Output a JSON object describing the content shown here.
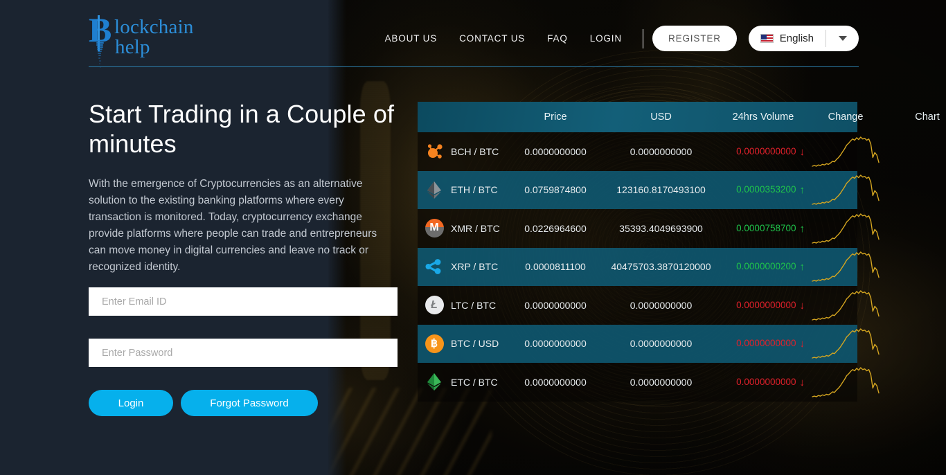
{
  "brand": {
    "logo_line1": "lockchain",
    "logo_line2": "help",
    "logo_initial": "B"
  },
  "header": {
    "nav": [
      {
        "label": "ABOUT US"
      },
      {
        "label": "CONTACT US"
      },
      {
        "label": "FAQ"
      },
      {
        "label": "LOGIN"
      }
    ],
    "register_label": "REGISTER",
    "language": {
      "label": "English",
      "flag_icon": "us-flag-icon",
      "caret_icon": "chevron-down-icon"
    }
  },
  "hero": {
    "title": "Start Trading in a Couple of minutes",
    "paragraph": "With the emergence of Cryptocurrencies as an alternative solution to the existing banking platforms where every transaction is monitored. Today, cryptocurrency exchange provide platforms where people can trade and entrepreneurs can move money in digital currencies and leave no track or recognized identity.",
    "email_placeholder": "Enter Email ID",
    "email_value": "",
    "password_placeholder": "Enter Password",
    "password_value": "",
    "login_label": "Login",
    "forgot_label": "Forgot Password"
  },
  "market": {
    "columns": [
      {
        "key": "icon",
        "label": ""
      },
      {
        "key": "pair",
        "label": ""
      },
      {
        "key": "price",
        "label": "Price"
      },
      {
        "key": "usd",
        "label": "USD"
      },
      {
        "key": "vol",
        "label": "24hrs Volume"
      },
      {
        "key": "chg",
        "label": "Change"
      },
      {
        "key": "chart",
        "label": "Chart"
      }
    ],
    "colors": {
      "header_bg": "#0f5066",
      "row_alt_bg": "#0e556e",
      "up": "#1fc44b",
      "down": "#e2202b",
      "spark": "#d4a520"
    },
    "rows": [
      {
        "icon": "bch-icon",
        "pair": "BCH / BTC",
        "price": "0.0000000000",
        "volume": "0.0000000000",
        "change": "0.0000000000",
        "direction": "down",
        "highlight": false
      },
      {
        "icon": "eth-icon",
        "pair": "ETH / BTC",
        "price": "0.0759874800",
        "volume": "123160.8170493100",
        "change": "0.0000353200",
        "direction": "up",
        "highlight": true
      },
      {
        "icon": "xmr-icon",
        "pair": "XMR / BTC",
        "price": "0.0226964600",
        "volume": "35393.4049693900",
        "change": "0.0000758700",
        "direction": "up",
        "highlight": false
      },
      {
        "icon": "xrp-icon",
        "pair": "XRP / BTC",
        "price": "0.0000811100",
        "volume": "40475703.3870120000",
        "change": "0.0000000200",
        "direction": "up",
        "highlight": true
      },
      {
        "icon": "ltc-icon",
        "pair": "LTC / BTC",
        "price": "0.0000000000",
        "volume": "0.0000000000",
        "change": "0.0000000000",
        "direction": "down",
        "highlight": false
      },
      {
        "icon": "btc-icon",
        "pair": "BTC / USD",
        "price": "0.0000000000",
        "volume": "0.0000000000",
        "change": "0.0000000000",
        "direction": "down",
        "highlight": true
      },
      {
        "icon": "etc-icon",
        "pair": "ETC / BTC",
        "price": "0.0000000000",
        "volume": "0.0000000000",
        "change": "0.0000000000",
        "direction": "down",
        "highlight": false
      }
    ],
    "sparkline": {
      "label": "price-trend-sparkline",
      "values": [
        8,
        9,
        8,
        10,
        9,
        11,
        10,
        12,
        11,
        13,
        16,
        15,
        19,
        22,
        26,
        31,
        36,
        42,
        45,
        49,
        52,
        50,
        54,
        51,
        55,
        52,
        53,
        50,
        52,
        44,
        22,
        30,
        26,
        14
      ]
    }
  },
  "theme": {
    "panel_bg": "#1b2430",
    "accent_blue": "#06b0ec",
    "logo_blue": "#2c8ed8",
    "rule_blue": "#2d7fad"
  }
}
